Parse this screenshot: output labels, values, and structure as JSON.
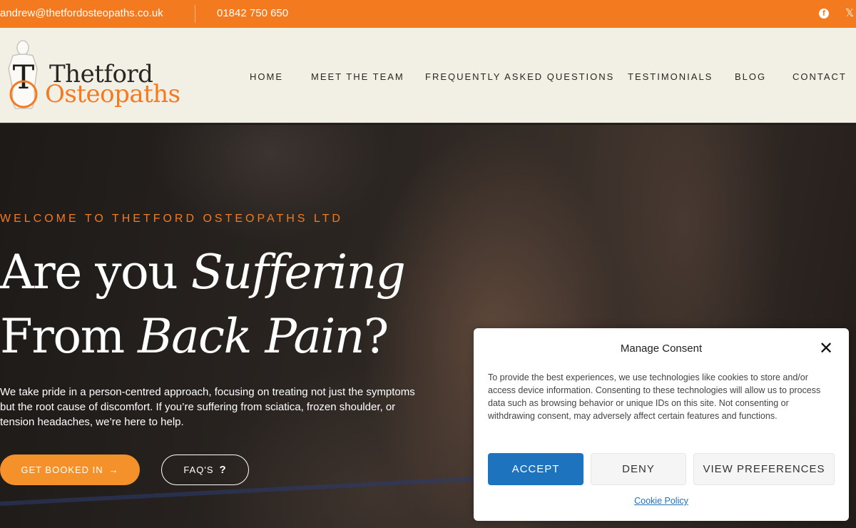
{
  "topbar": {
    "email": "andrew@thetfordosteopaths.co.uk",
    "phone": "01842 750 650",
    "social": [
      {
        "icon": "facebook-icon",
        "glyph": "f"
      },
      {
        "icon": "x-twitter-icon",
        "glyph": "𝕏"
      }
    ]
  },
  "header": {
    "logo": {
      "line1": "Thetford",
      "line2": "Osteopaths",
      "brand_color": "#f47a20"
    },
    "nav": [
      "HOME",
      "MEET THE TEAM",
      "FREQUENTLY ASKED QUESTIONS",
      "TESTIMONIALS",
      "BLOG",
      "CONTACT"
    ]
  },
  "hero": {
    "eyebrow": "WELCOME TO THETFORD OSTEOPATHS LTD",
    "headline": {
      "line1_plain": "Are you ",
      "line1_italic": "Suffering",
      "line2_plain": "From ",
      "line2_italic": "Back Pain",
      "line2_end": "?"
    },
    "description": "We take pride in a person-centred approach, focusing on treating not just the symptoms but the root cause of discomfort. If you’re suffering from sciatica, frozen shoulder, or tension headaches, we’re here to help.",
    "buttons": {
      "book": "GET BOOKED IN",
      "book_icon": "→",
      "faq": "FAQ'S",
      "faq_icon": "?"
    }
  },
  "consent": {
    "title": "Manage Consent",
    "close_icon": "✕",
    "text": "To provide the best experiences, we use technologies like cookies to store and/or access device information. Consenting to these technologies will allow us to process data such as browsing behavior or unique IDs on this site. Not consenting or withdrawing consent, may adversely affect certain features and functions.",
    "accept": "ACCEPT",
    "deny": "DENY",
    "preferences": "VIEW PREFERENCES",
    "policy_link": "Cookie Policy",
    "accent": "#1e73be"
  }
}
